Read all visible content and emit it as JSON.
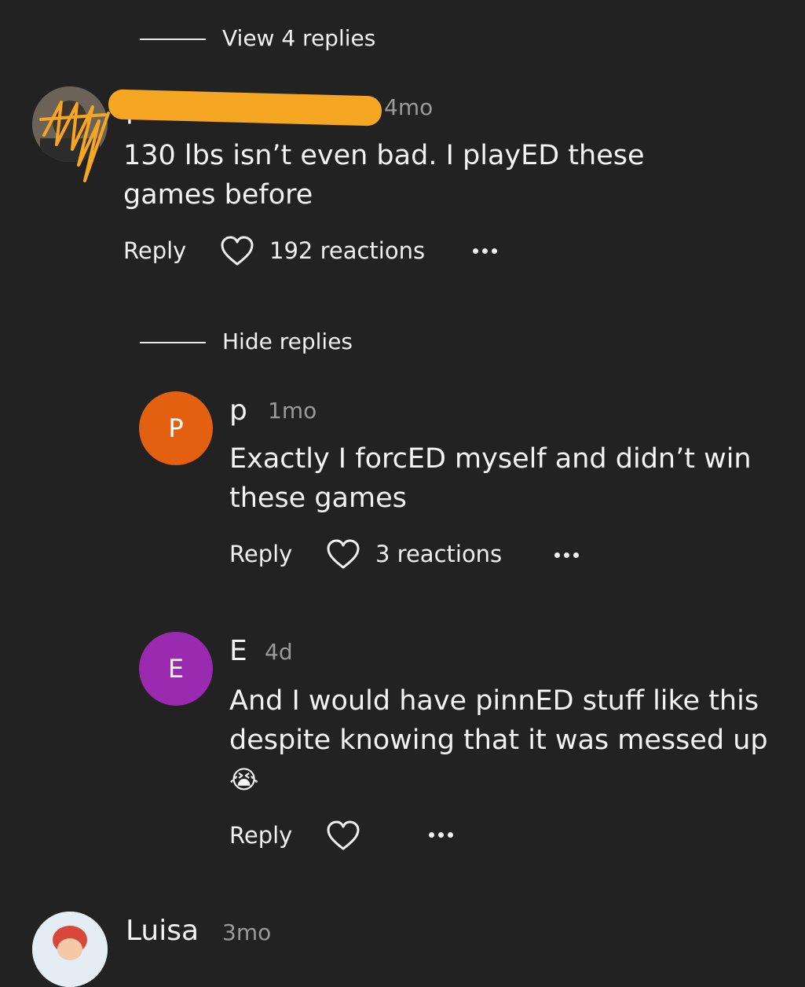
{
  "thread1": {
    "toggle_label": "View 4 replies"
  },
  "comment1": {
    "author": "p",
    "time": "4mo",
    "text": "130 lbs isn’t even bad. I playED these games before",
    "reply_label": "Reply",
    "reactions_label": "192 reactions",
    "icons": [
      "avatar-photo",
      "heart-icon",
      "more-icon"
    ]
  },
  "thread2": {
    "toggle_label": "Hide replies"
  },
  "reply1": {
    "avatar_letter": "P",
    "avatar_color": "#e2600f",
    "author": "p",
    "time": "1mo",
    "text": "Exactly I forcED myself and didn’t win these games",
    "reply_label": "Reply",
    "reactions_label": "3 reactions"
  },
  "reply2": {
    "avatar_letter": "E",
    "avatar_color": "#9a2bb0",
    "author": "E",
    "time": "4d",
    "text": "And I would have pinnED stuff like this despite knowing that it was messed up",
    "emoji": "😭",
    "reply_label": "Reply"
  },
  "comment2": {
    "author": "Luisa",
    "time": "3mo"
  },
  "colors": {
    "background": "#222222",
    "text": "#f2f2f2",
    "muted": "#9a9a9a",
    "redaction": "#f5a623"
  }
}
